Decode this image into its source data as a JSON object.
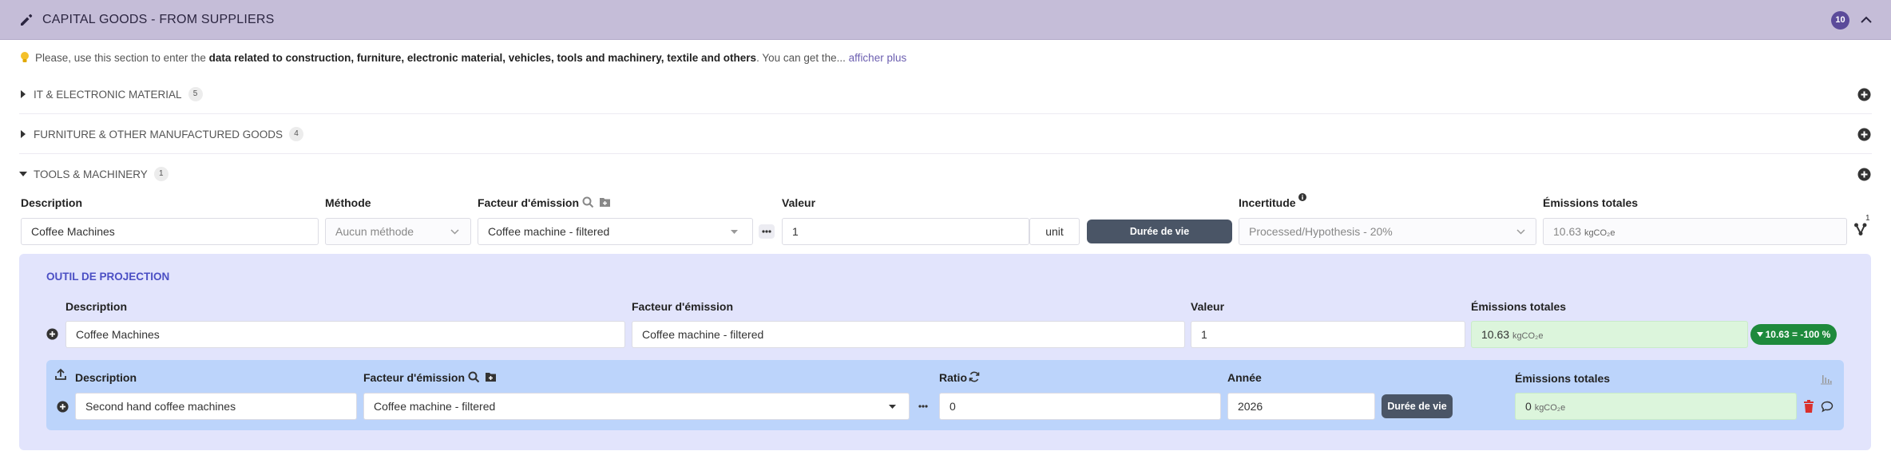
{
  "header": {
    "title": "CAPITAL GOODS - FROM SUPPLIERS",
    "count": "10"
  },
  "info": {
    "intro": "Please, use this section to enter the ",
    "bold": "data related to construction, furniture, electronic material, vehicles, tools and machinery, textile and others",
    "tail": ". You can get the... ",
    "more": "afficher plus"
  },
  "categories": [
    {
      "label": "IT & ELECTRONIC MATERIAL",
      "count": "5"
    },
    {
      "label": "FURNITURE & OTHER MANUFACTURED GOODS",
      "count": "4"
    },
    {
      "label": "TOOLS & MACHINERY",
      "count": "1"
    }
  ],
  "main_labels": {
    "description": "Description",
    "methode": "Méthode",
    "facteur": "Facteur d'émission",
    "valeur": "Valeur",
    "incertitude": "Incertitude",
    "emissions": "Émissions totales"
  },
  "row": {
    "description": "Coffee Machines",
    "methode": "Aucun méthode",
    "facteur": "Coffee machine - filtered",
    "valeur": "1",
    "unit": "unit",
    "duree_btn": "Durée de vie",
    "incertitude": "Processed/Hypothesis - 20%",
    "emissions_value": "10.63",
    "emissions_unit": "kgCO₂e",
    "branch_count": "1"
  },
  "projection": {
    "title": "OUTIL DE PROJECTION",
    "labels": {
      "description": "Description",
      "facteur": "Facteur d'émission",
      "valeur": "Valeur",
      "emissions": "Émissions totales"
    },
    "row": {
      "description": "Coffee Machines",
      "facteur": "Coffee machine - filtered",
      "valeur": "1",
      "emissions_value": "10.63",
      "emissions_unit": "kgCO₂e",
      "pill": "10.63 = -100 %"
    }
  },
  "sub": {
    "labels": {
      "description": "Description",
      "facteur": "Facteur d'émission",
      "ratio": "Ratio",
      "annee": "Année",
      "emissions": "Émissions totales"
    },
    "row": {
      "description": "Second hand coffee machines",
      "facteur": "Coffee machine - filtered",
      "ratio": "0",
      "annee": "2026",
      "duree_btn": "Durée de vie",
      "emissions_value": "0",
      "emissions_unit": "kgCO₂e"
    }
  }
}
